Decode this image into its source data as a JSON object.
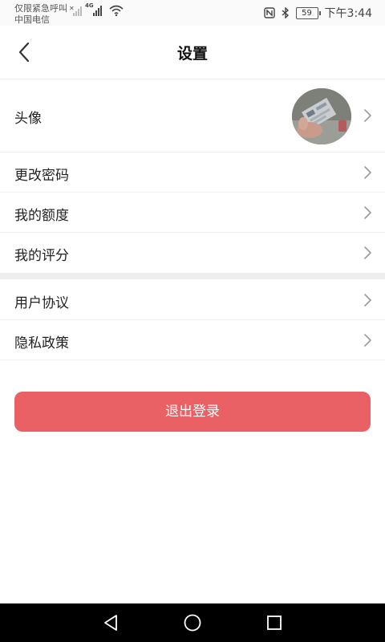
{
  "status_bar": {
    "carrier_line1": "仅限紧急呼叫",
    "carrier_line2": "中国电信",
    "network_type": "4G",
    "battery_level": "59",
    "time": "下午3:44"
  },
  "header": {
    "title": "设置"
  },
  "settings_group1": [
    {
      "label": "头像",
      "has_avatar": true
    },
    {
      "label": "更改密码"
    },
    {
      "label": "我的额度"
    },
    {
      "label": "我的评分"
    }
  ],
  "settings_group2": [
    {
      "label": "用户协议"
    },
    {
      "label": "隐私政策"
    }
  ],
  "logout_label": "退出登录",
  "colors": {
    "accent": "#e96165",
    "background": "#ffffff",
    "divider": "#eeeeee",
    "navbar": "#000000"
  },
  "icons": {
    "back": "chevron-left-icon",
    "row_arrow": "chevron-right-icon",
    "nav_back": "triangle-back-icon",
    "nav_home": "circle-home-icon",
    "nav_recent": "square-recent-icon"
  }
}
